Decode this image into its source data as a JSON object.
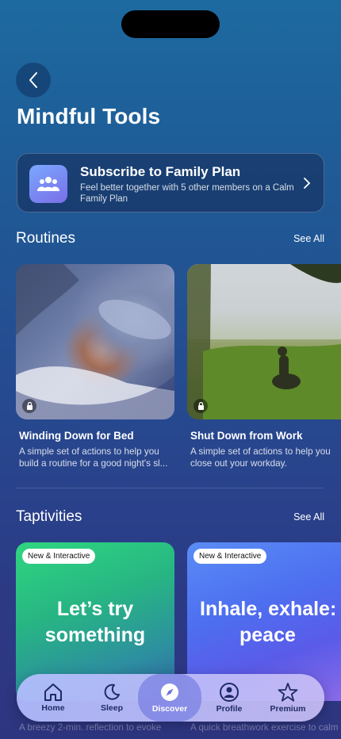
{
  "header": {
    "title": "Mindful Tools"
  },
  "family_plan": {
    "title": "Subscribe to Family Plan",
    "subtitle": "Feel better together with 5 other members on a Calm Family Plan"
  },
  "routines": {
    "title": "Routines",
    "see_all": "See All",
    "items": [
      {
        "title": "Winding Down for Bed",
        "desc_line1": "A simple set of actions to help you",
        "desc_line2": "build a routine for a good night's sl..."
      },
      {
        "title": "Shut Down from Work",
        "desc_line1": "A simple set of actions to help you",
        "desc_line2": "close out your workday."
      }
    ]
  },
  "taptivities": {
    "title": "Taptivities",
    "see_all": "See All",
    "items": [
      {
        "badge": "New & Interactive",
        "line1": "Let’s try",
        "line2": "something",
        "peek": "A breezy 2-min. reflection to evoke"
      },
      {
        "badge": "New & Interactive",
        "line1": "Inhale, exhale:",
        "line2": "peace",
        "peek": "A quick breathwork exercise to calm"
      }
    ]
  },
  "tabbar": {
    "tabs": [
      {
        "label": "Home",
        "icon": "home-icon"
      },
      {
        "label": "Sleep",
        "icon": "moon-icon"
      },
      {
        "label": "Discover",
        "icon": "compass-icon",
        "active": true
      },
      {
        "label": "Profile",
        "icon": "person-icon"
      },
      {
        "label": "Premium",
        "icon": "star-icon"
      }
    ]
  },
  "colors": {
    "accent": "#7a6ee8",
    "tabbar": "#b8bdf8"
  }
}
